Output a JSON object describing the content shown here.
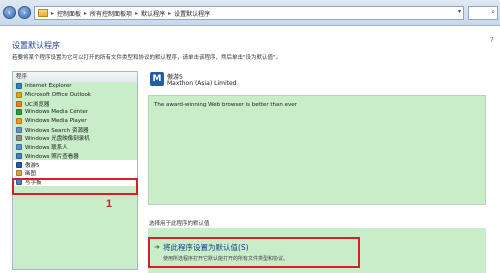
{
  "address_bar": {
    "crumbs": [
      "控制面板",
      "所有控制面板项",
      "默认程序",
      "设置默认程序"
    ]
  },
  "page": {
    "title": "设置默认程序",
    "description": "若要将某个程序设置为它可以打开的所有文件类型和协议的默认程序，请单击该程序，然后单击\"设为默认值\"。"
  },
  "program_list": {
    "header": "程序",
    "items": [
      {
        "label": "Internet Explorer",
        "icon": "internet-explorer-icon",
        "color": "#2b7fd6"
      },
      {
        "label": "Microsoft Office Outlook",
        "icon": "outlook-icon",
        "color": "#e8a21e"
      },
      {
        "label": "UC浏览器",
        "icon": "uc-browser-icon",
        "color": "#f07f1f"
      },
      {
        "label": "Windows Media Center",
        "icon": "media-center-icon",
        "color": "#2e9c3a"
      },
      {
        "label": "Windows Media Player",
        "icon": "media-player-icon",
        "color": "#f39c12"
      },
      {
        "label": "Windows Search 资源器",
        "icon": "windows-search-icon",
        "color": "#6a8fc4"
      },
      {
        "label": "Windows 光盘映像刻录机",
        "icon": "disc-burner-icon",
        "color": "#8c8c8c"
      },
      {
        "label": "Windows 联系人",
        "icon": "contacts-icon",
        "color": "#5a8fd1"
      },
      {
        "label": "Windows 照片查看器",
        "icon": "photo-viewer-icon",
        "color": "#3f7fc4"
      },
      {
        "label": "傲游5",
        "icon": "maxthon-icon",
        "color": "#1f5fa8"
      },
      {
        "label": "画图",
        "icon": "paint-icon",
        "color": "#d9a441"
      },
      {
        "label": "写字板",
        "icon": "wordpad-icon",
        "color": "#4c7fc2"
      }
    ]
  },
  "annotation_marker": "1",
  "selected_app": {
    "name": "傲游5",
    "company": "Maxthon (Asia) Limited",
    "description": "The award-winning Web browser is better than ever"
  },
  "select_label": "选择用于此程序的默认值",
  "action": {
    "title": "将此程序设置为默认值(S)",
    "subtitle": "使用所选程序打开它默认能打开的所有文件类型和协议。"
  },
  "colors": {
    "list_background": "#c9ecc9",
    "highlight_box": "#d4202a",
    "title": "#1e3f8f"
  }
}
